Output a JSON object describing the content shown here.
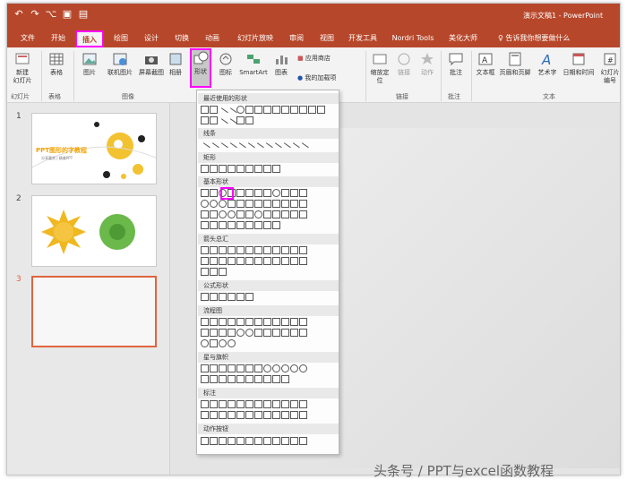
{
  "window": {
    "title": "演示文稿1  -  PowerPoint"
  },
  "qat_icons": [
    "undo-icon",
    "redo-icon",
    "format-painter-icon",
    "save-icon",
    "present-icon"
  ],
  "tabs": [
    "文件",
    "开始",
    "插入",
    "绘图",
    "设计",
    "切换",
    "动画",
    "幻灯片放映",
    "审阅",
    "视图",
    "开发工具",
    "Nordri Tools",
    "美化大师"
  ],
  "active_tab": "插入",
  "tell_me": "告诉我你想要做什么",
  "ribbon": {
    "new_slide": "新建\n幻灯片",
    "table": "表格",
    "picture": "图片",
    "online_picture": "联机图片",
    "screenshot": "屏幕截图",
    "album": "相册",
    "shapes": "形状",
    "icons": "图标",
    "smartart": "SmartArt",
    "chart": "图表",
    "app_store": "应用商店",
    "my_addins": "我的加载项",
    "zoom": "缩放定\n位",
    "link": "链接",
    "action": "动作",
    "comment": "批注",
    "textbox": "文本框",
    "header_footer": "页眉和页脚",
    "wordart": "艺术字",
    "datetime": "日期和时间",
    "slide_number": "幻灯片\n编号",
    "groups": {
      "slides": "幻灯片",
      "tables": "表格",
      "images": "图像",
      "links": "链接",
      "comments": "批注",
      "text": "文本"
    }
  },
  "slides": [
    {
      "num": "1",
      "title": "PPT图形的字教程",
      "subtitle": "分享嘉宾 | 精美PPT"
    },
    {
      "num": "2"
    },
    {
      "num": "3"
    }
  ],
  "shapes_menu": {
    "sections": [
      "最近使用的形状",
      "线条",
      "矩形",
      "基本形状",
      "箭头总汇",
      "公式形状",
      "流程图",
      "星与旗帜",
      "标注",
      "动作按钮"
    ]
  },
  "watermark": "头条号 / PPT与excel函数教程",
  "colors": {
    "accent": "#b7472a",
    "highlight": "#ff00ff"
  }
}
